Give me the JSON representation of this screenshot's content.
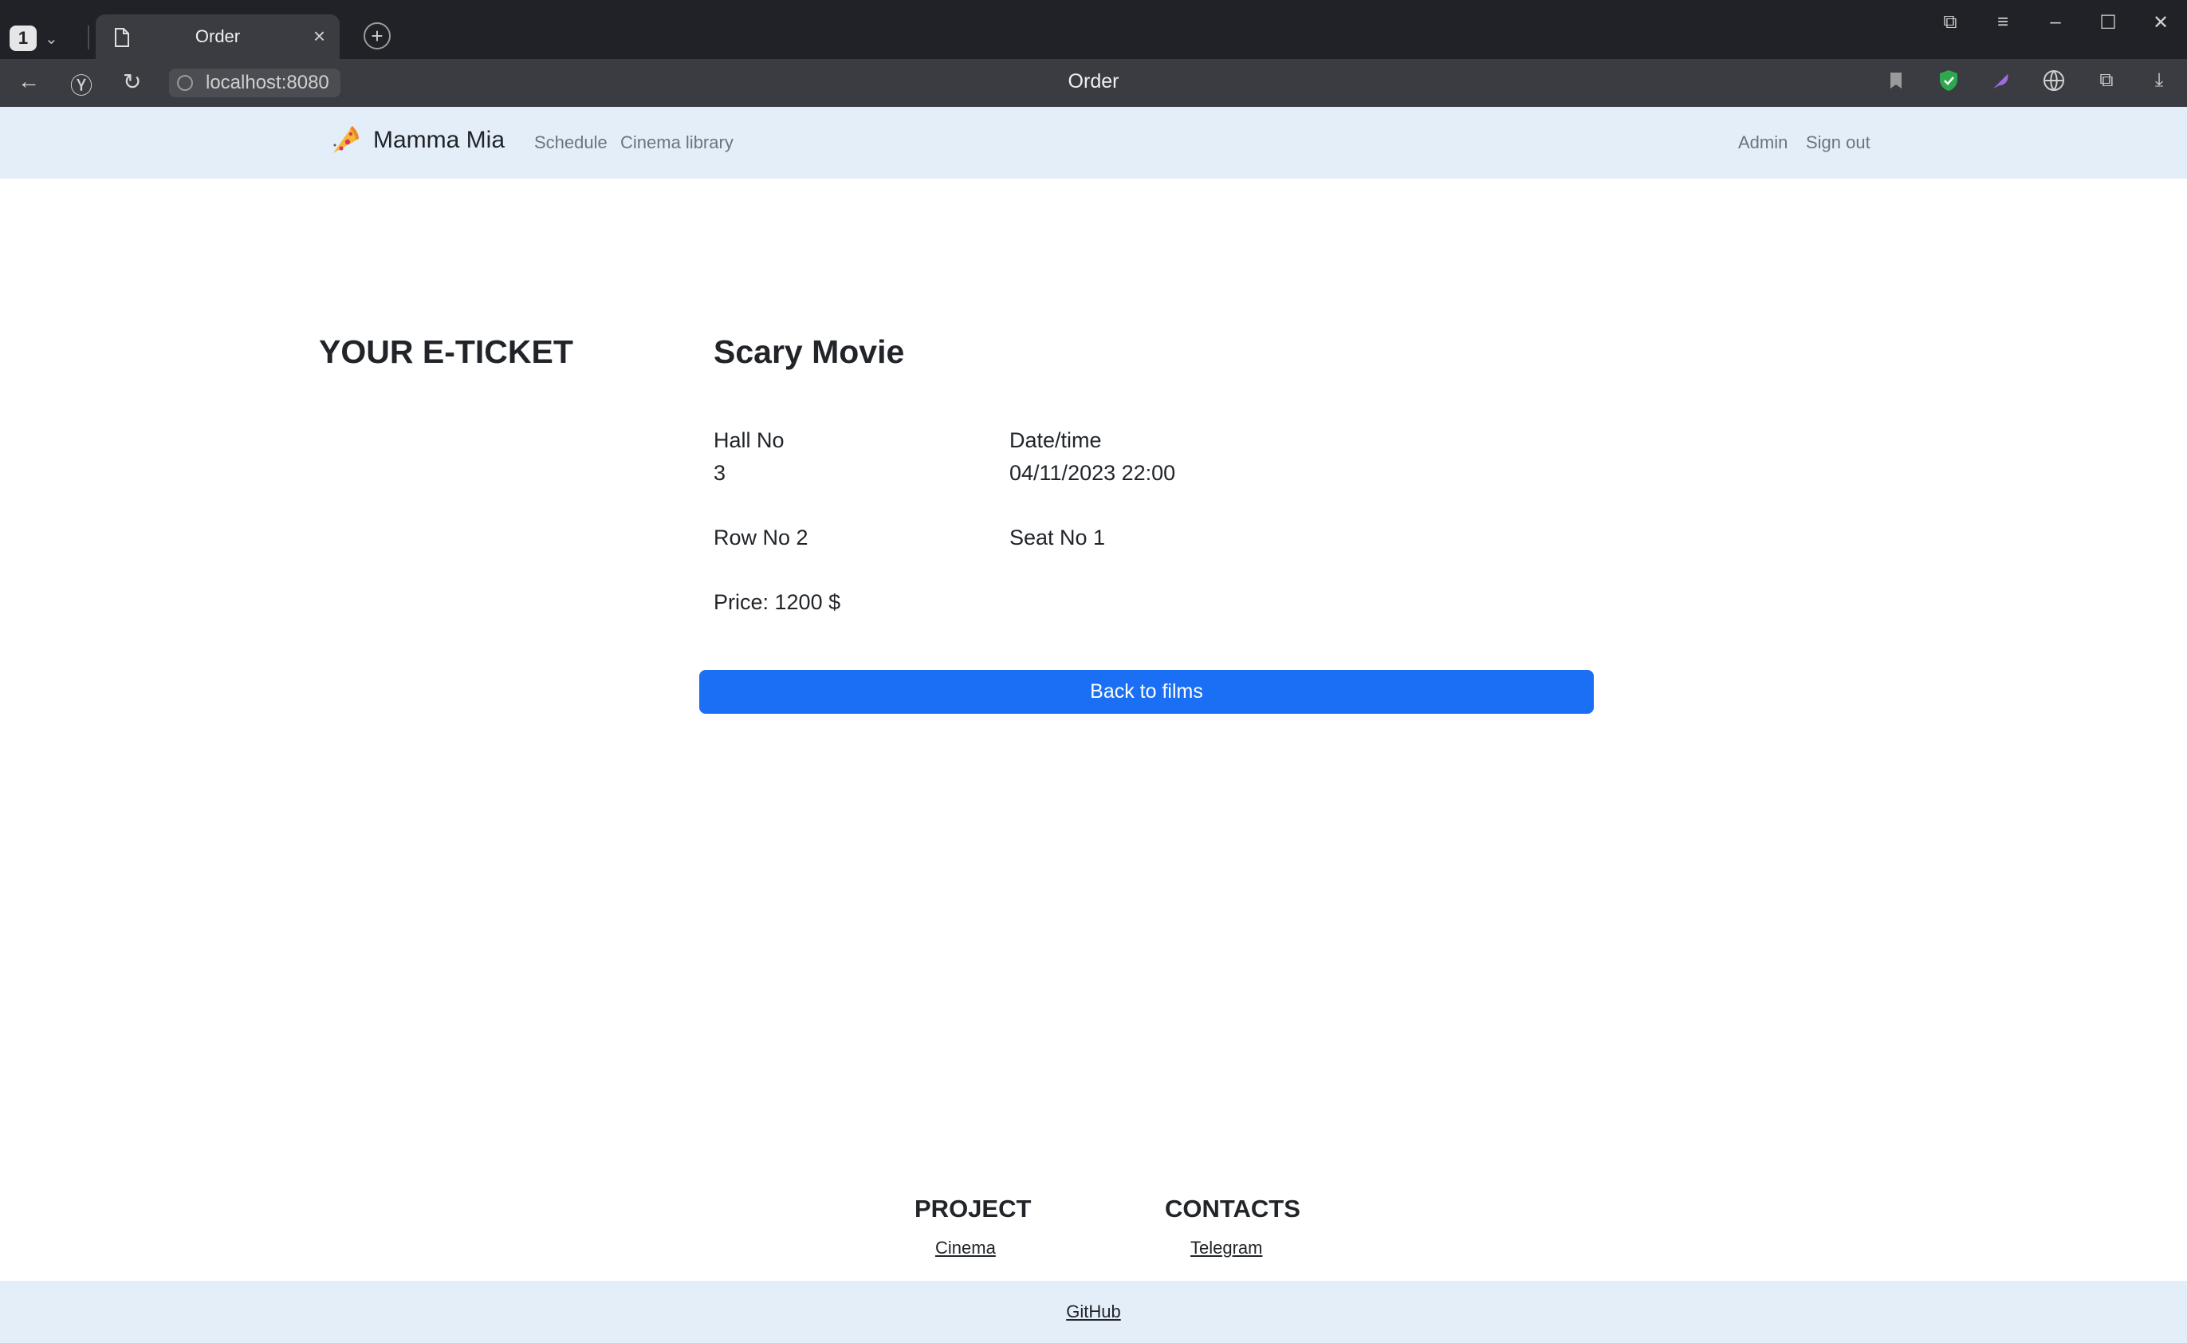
{
  "browser": {
    "tab_count": "1",
    "tab_title": "Order",
    "url": "localhost:8080",
    "page_title": "Order"
  },
  "nav": {
    "brand": "Mamma Mia",
    "links": [
      "Schedule",
      "Cinema library"
    ],
    "admin": "Admin",
    "sign_out": "Sign out"
  },
  "ticket": {
    "heading": "YOUR E-TICKET",
    "film": "Scary Movie",
    "hall_label": "Hall No",
    "hall_value": "3",
    "datetime_label": "Date/time",
    "datetime_value": "04/11/2023 22:00",
    "row": "Row No 2",
    "seat": "Seat No 1",
    "price": "Price: 1200 $",
    "back_button": "Back to films"
  },
  "footer": {
    "project_heading": "PROJECT",
    "project_link": "Cinema",
    "contacts_heading": "CONTACTS",
    "contacts_link": "Telegram",
    "github": "GitHub"
  },
  "colors": {
    "nav_bg": "#e4eef9",
    "primary": "#1a6ff5",
    "chrome_dark": "#202227",
    "chrome_bar": "#3a3c41"
  }
}
